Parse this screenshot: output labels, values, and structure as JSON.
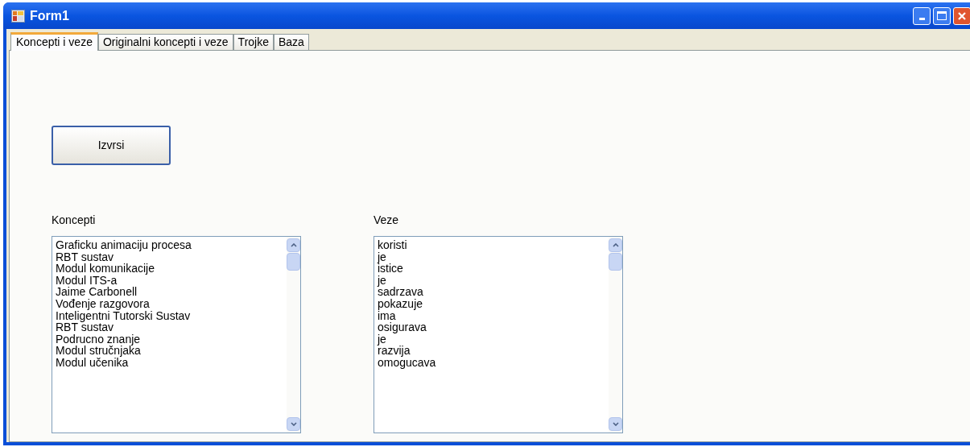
{
  "window": {
    "title": "Form1"
  },
  "tabs": [
    {
      "label": "Koncepti i veze",
      "selected": true
    },
    {
      "label": "Originalni koncepti i veze",
      "selected": false
    },
    {
      "label": "Trojke",
      "selected": false
    },
    {
      "label": "Baza",
      "selected": false
    }
  ],
  "run_button": "Izvrsi",
  "lists": [
    {
      "label": "Koncepti",
      "items": [
        "Graficku animaciju procesa",
        "RBT sustav",
        "Modul komunikacije",
        "Modul ITS-a",
        "Jaime Carbonell",
        "Vođenje razgovora",
        "Inteligentni Tutorski Sustav",
        "RBT sustav",
        "Podrucno znanje",
        "Modul stručnjaka",
        "Modul učenika"
      ]
    },
    {
      "label": "Veze",
      "items": [
        "koristi",
        "je",
        "istice",
        "je",
        "sadrzava",
        "pokazuje",
        "ima",
        "osigurava",
        "je",
        "razvija",
        "omogucava"
      ]
    }
  ]
}
